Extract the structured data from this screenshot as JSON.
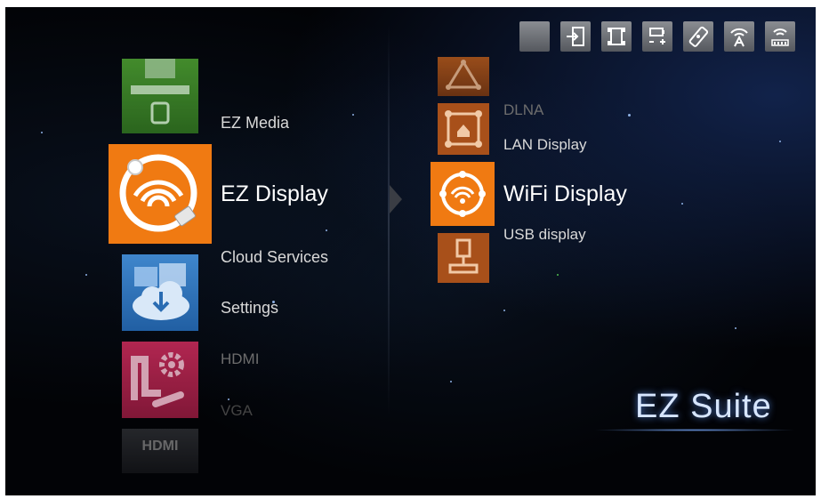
{
  "left_menu": {
    "items": [
      {
        "label": "EZ Media"
      },
      {
        "label": "EZ Display"
      },
      {
        "label": "Cloud Services"
      },
      {
        "label": "Settings"
      },
      {
        "label": "HDMI"
      },
      {
        "label": "VGA"
      }
    ],
    "tile_icons": [
      "usb-green-icon",
      "ez-display-wifi-icon",
      "cloud-services-icon",
      "settings-wrench-icon",
      "hdmi-icon"
    ],
    "tile_colors": {
      "green": "#3e8a2a",
      "orange": "#f07a12",
      "blue": "#2a6cb3",
      "red": "#b31f4b",
      "gray": "#55585e"
    },
    "hdmi_tile_text": "HDMI"
  },
  "right_menu": {
    "items": [
      {
        "label": "DLNA"
      },
      {
        "label": "LAN Display"
      },
      {
        "label": "WiFi Display"
      },
      {
        "label": "USB display"
      }
    ],
    "tile_icons": [
      "dlna-network-icon",
      "lan-display-icon",
      "wifi-display-icon",
      "usb-display-icon"
    ],
    "tile_colors": {
      "active": "#f07a12",
      "inactive": "#a84a12"
    }
  },
  "top_bar": {
    "icons": [
      "blank-icon",
      "usb-input-icon",
      "network-icon",
      "battery-volume-icon",
      "remote-icon",
      "wifi-antenna-icon",
      "signal-strength-icon"
    ]
  },
  "branding": {
    "text": "EZ Suite"
  }
}
